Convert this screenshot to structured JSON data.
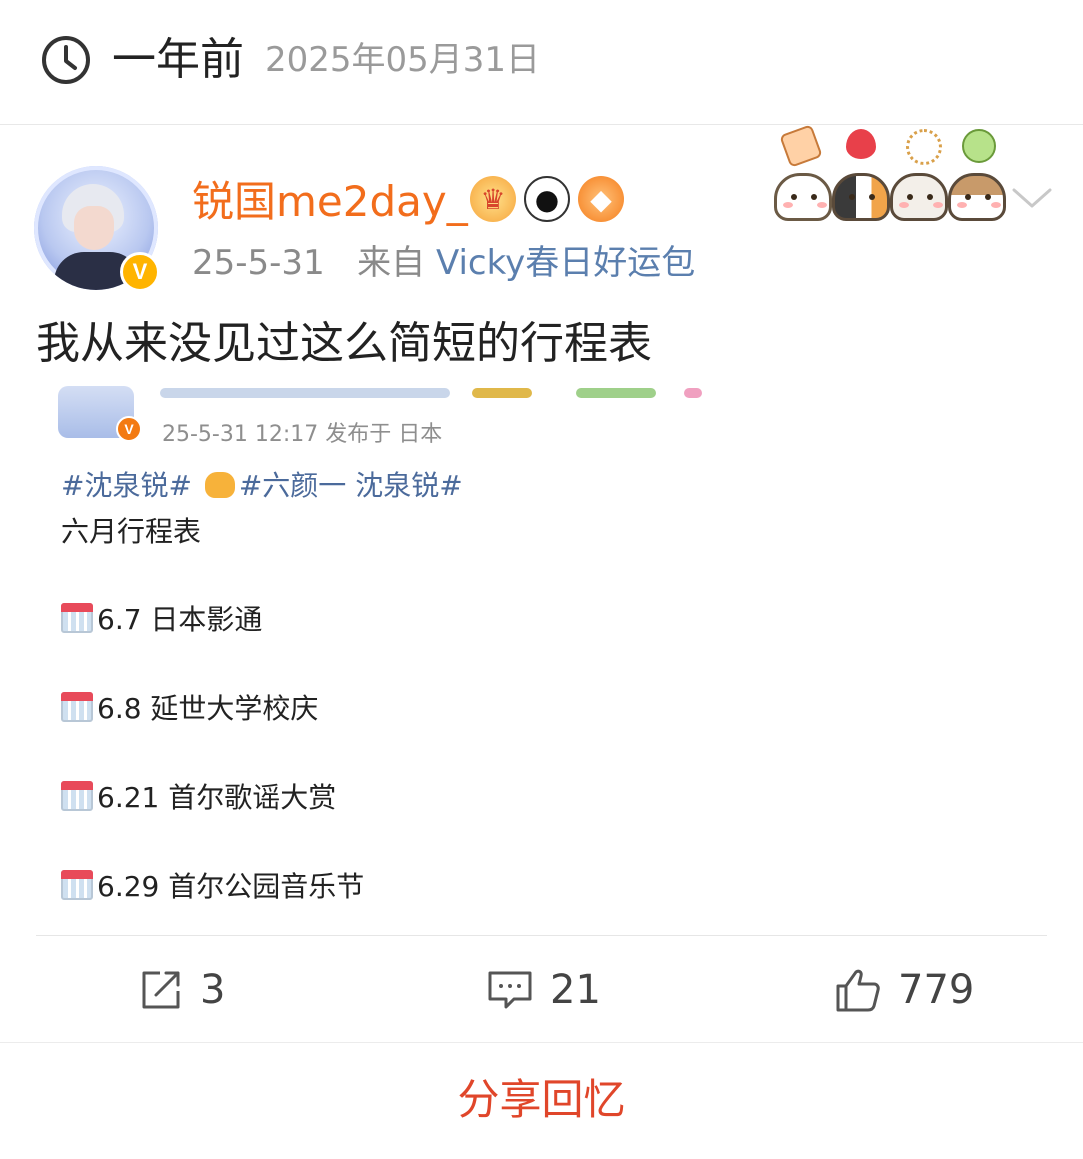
{
  "header": {
    "relative_time": "一年前",
    "date": "2025年05月31日"
  },
  "post": {
    "username": "锐国me2day_",
    "badges": [
      "crown-badge-icon",
      "panda-badge-icon",
      "fish-badge-icon"
    ],
    "date": "25-5-31",
    "source_prefix": "来自",
    "source": "Vicky春日好运包",
    "text": "我从来没见过这么简短的行程表",
    "colors": {
      "username": "#f26d1c",
      "source": "#5b7fae",
      "share": "#e0462a"
    }
  },
  "screenshot": {
    "meta": "25-5-31 12:17  发布于 日本",
    "tags_a": "#沈泉锐#",
    "tags_b": "#六颜一 沈泉锐#",
    "subtitle": "六月行程表",
    "schedule": [
      {
        "text": "6.7 日本影通"
      },
      {
        "text": "6.8 延世大学校庆"
      },
      {
        "text": "6.21 首尔歌谣大赏"
      },
      {
        "text": "6.29 首尔公园音乐节"
      }
    ]
  },
  "actions": {
    "reposts": "3",
    "comments": "21",
    "likes": "779"
  },
  "footer": {
    "share_label": "分享回忆"
  }
}
